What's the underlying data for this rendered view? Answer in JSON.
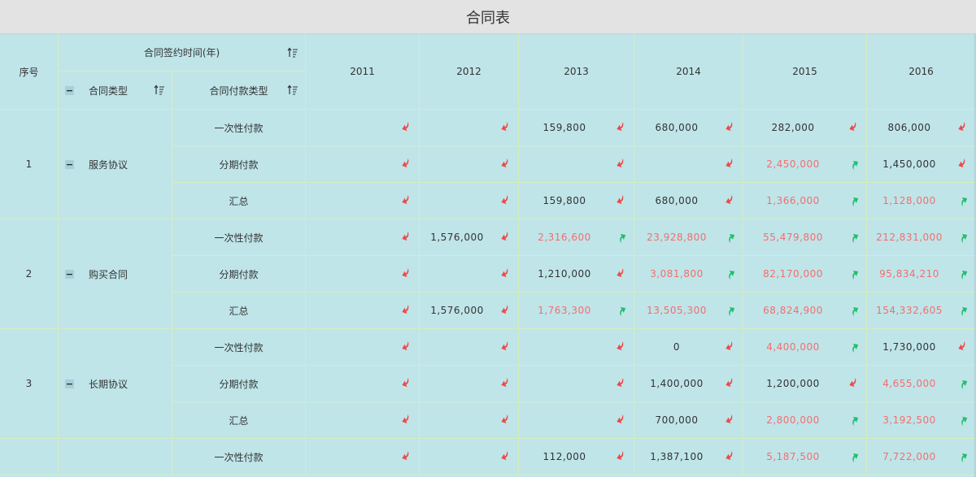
{
  "title": "合同表",
  "header": {
    "seq": "序号",
    "sign_time": "合同签约时间(年)",
    "contract_type": "合同类型",
    "payment_type": "合同付款类型",
    "years": [
      "2011",
      "2012",
      "2013",
      "2014",
      "2015",
      "2016"
    ]
  },
  "groups": [
    {
      "seq": "1",
      "name": "服务协议",
      "rows": [
        {
          "label": "一次性付款",
          "cells": [
            {
              "v": "",
              "c": "norm",
              "a": "down"
            },
            {
              "v": "",
              "c": "norm",
              "a": "down"
            },
            {
              "v": "159,800",
              "c": "norm",
              "a": "down"
            },
            {
              "v": "680,000",
              "c": "norm",
              "a": "down"
            },
            {
              "v": "282,000",
              "c": "norm",
              "a": "down"
            },
            {
              "v": "806,000",
              "c": "norm",
              "a": "down"
            }
          ]
        },
        {
          "label": "分期付款",
          "cells": [
            {
              "v": "",
              "c": "norm",
              "a": "down"
            },
            {
              "v": "",
              "c": "norm",
              "a": "down"
            },
            {
              "v": "",
              "c": "norm",
              "a": "down"
            },
            {
              "v": "",
              "c": "norm",
              "a": "down"
            },
            {
              "v": "2,450,000",
              "c": "red",
              "a": "up"
            },
            {
              "v": "1,450,000",
              "c": "norm",
              "a": "down"
            }
          ]
        },
        {
          "label": "汇总",
          "cells": [
            {
              "v": "",
              "c": "norm",
              "a": "down"
            },
            {
              "v": "",
              "c": "norm",
              "a": "down"
            },
            {
              "v": "159,800",
              "c": "norm",
              "a": "down"
            },
            {
              "v": "680,000",
              "c": "norm",
              "a": "down"
            },
            {
              "v": "1,366,000",
              "c": "red",
              "a": "up"
            },
            {
              "v": "1,128,000",
              "c": "red",
              "a": "up"
            }
          ]
        }
      ]
    },
    {
      "seq": "2",
      "name": "购买合同",
      "rows": [
        {
          "label": "一次性付款",
          "cells": [
            {
              "v": "",
              "c": "norm",
              "a": "down"
            },
            {
              "v": "1,576,000",
              "c": "norm",
              "a": "down"
            },
            {
              "v": "2,316,600",
              "c": "red",
              "a": "up"
            },
            {
              "v": "23,928,800",
              "c": "red",
              "a": "up"
            },
            {
              "v": "55,479,800",
              "c": "red",
              "a": "up"
            },
            {
              "v": "212,831,000",
              "c": "red",
              "a": "up"
            }
          ]
        },
        {
          "label": "分期付款",
          "cells": [
            {
              "v": "",
              "c": "norm",
              "a": "down"
            },
            {
              "v": "",
              "c": "norm",
              "a": "down"
            },
            {
              "v": "1,210,000",
              "c": "norm",
              "a": "down"
            },
            {
              "v": "3,081,800",
              "c": "red",
              "a": "up"
            },
            {
              "v": "82,170,000",
              "c": "red",
              "a": "up"
            },
            {
              "v": "95,834,210",
              "c": "red",
              "a": "up"
            }
          ]
        },
        {
          "label": "汇总",
          "cells": [
            {
              "v": "",
              "c": "norm",
              "a": "down"
            },
            {
              "v": "1,576,000",
              "c": "norm",
              "a": "down"
            },
            {
              "v": "1,763,300",
              "c": "red",
              "a": "up"
            },
            {
              "v": "13,505,300",
              "c": "red",
              "a": "up"
            },
            {
              "v": "68,824,900",
              "c": "red",
              "a": "up"
            },
            {
              "v": "154,332,605",
              "c": "red",
              "a": "up"
            }
          ]
        }
      ]
    },
    {
      "seq": "3",
      "name": "长期协议",
      "rows": [
        {
          "label": "一次性付款",
          "cells": [
            {
              "v": "",
              "c": "norm",
              "a": "down"
            },
            {
              "v": "",
              "c": "norm",
              "a": "down"
            },
            {
              "v": "",
              "c": "norm",
              "a": "down"
            },
            {
              "v": "0",
              "c": "norm",
              "a": "down"
            },
            {
              "v": "4,400,000",
              "c": "red",
              "a": "up"
            },
            {
              "v": "1,730,000",
              "c": "norm",
              "a": "down"
            }
          ]
        },
        {
          "label": "分期付款",
          "cells": [
            {
              "v": "",
              "c": "norm",
              "a": "down"
            },
            {
              "v": "",
              "c": "norm",
              "a": "down"
            },
            {
              "v": "",
              "c": "norm",
              "a": "down"
            },
            {
              "v": "1,400,000",
              "c": "norm",
              "a": "down"
            },
            {
              "v": "1,200,000",
              "c": "norm",
              "a": "down"
            },
            {
              "v": "4,655,000",
              "c": "red",
              "a": "up"
            }
          ]
        },
        {
          "label": "汇总",
          "cells": [
            {
              "v": "",
              "c": "norm",
              "a": "down"
            },
            {
              "v": "",
              "c": "norm",
              "a": "down"
            },
            {
              "v": "",
              "c": "norm",
              "a": "down"
            },
            {
              "v": "700,000",
              "c": "norm",
              "a": "down"
            },
            {
              "v": "2,800,000",
              "c": "red",
              "a": "up"
            },
            {
              "v": "3,192,500",
              "c": "red",
              "a": "up"
            }
          ]
        }
      ]
    },
    {
      "seq": "",
      "name": "",
      "rows": [
        {
          "label": "一次性付款",
          "cells": [
            {
              "v": "",
              "c": "norm",
              "a": "down"
            },
            {
              "v": "",
              "c": "norm",
              "a": "down"
            },
            {
              "v": "112,000",
              "c": "norm",
              "a": "down"
            },
            {
              "v": "1,387,100",
              "c": "norm",
              "a": "down"
            },
            {
              "v": "5,187,500",
              "c": "red",
              "a": "up"
            },
            {
              "v": "7,722,000",
              "c": "red",
              "a": "up"
            }
          ]
        }
      ]
    }
  ],
  "colors": {
    "up": "#1fbf6a",
    "down": "#f04848",
    "red_text": "#f36e6e"
  },
  "icons": {
    "sort": "sort-asc-icon",
    "up": "trend-up-arrow-icon",
    "down": "trend-down-arrow-icon",
    "collapse": "collapse-minus-icon"
  }
}
